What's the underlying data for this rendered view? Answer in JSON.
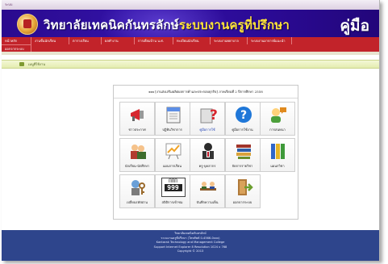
{
  "window": {
    "title": "ระบบ"
  },
  "banner": {
    "college_name": "วิทยาลัยเทคนิคกันทรลักษ์",
    "system_name": "ระบบงานครูที่ปรึกษา",
    "manual_label": "คู่มือ"
  },
  "menu": {
    "row1": [
      "หน้าหลัก",
      "งานขั้นนักเรียน",
      "ตารางเรียน",
      "ผลทำงาน",
      "การเยี่ยมบ้าน น.ศ.",
      "ทะเบียนนักเรียน",
      "ระบบงานพยาบาล",
      "ระบบงานอาจารย์แนะนำ"
    ],
    "row2": [
      "ออกจากระบบ"
    ]
  },
  "breadcrumb": {
    "text": "เมนูที่ใช้งาน"
  },
  "panel": {
    "header": "xxx [งานส่งเสริมผลิตผลการค้าและประกอบธุรกิจ] ภาคเรียนที่ 2 ปีการศึกษา 2558",
    "tiles": [
      {
        "label": "ข่าวประกาศ",
        "icon": "megaphone-icon",
        "color": "#d7262e"
      },
      {
        "label": "ปฏิทินวิชาการ",
        "icon": "calendar-icon",
        "color": "#5c8ee6"
      },
      {
        "label": "คู่มือการใช้",
        "icon": "question-book-icon",
        "color": "#d7262e"
      },
      {
        "label": "คู่มือการใช้งาน",
        "icon": "help-icon",
        "color": "#1f77d8"
      },
      {
        "label": "การสนทนา",
        "icon": "chat-users-icon",
        "color": "#e08a1e"
      },
      {
        "label": "นักเรียน-นักศึกษา",
        "icon": "students-icon",
        "color": "#3d6d2d"
      },
      {
        "label": "แผนการเรียน",
        "icon": "chart-board-icon",
        "color": "#f0a326"
      },
      {
        "label": "ครู-บุคลากร",
        "icon": "teacher-icon",
        "color": "#2a2a2a"
      },
      {
        "label": "จัดการรายวิชา",
        "icon": "books-icon",
        "color": "#a0342a"
      },
      {
        "label": "แผนกวิชา",
        "icon": "binders-icon",
        "color": "#2f66c9"
      },
      {
        "label": "เปลี่ยนรหัสผ่าน",
        "icon": "key-user-icon",
        "color": "#9a6a2c"
      },
      {
        "label": "สถิติการเข้าชม",
        "icon": "counter-icon",
        "color": "#333333"
      },
      {
        "label": "บันทึกความเห็น",
        "icon": "meeting-icon",
        "color": "#3a6a2a"
      },
      {
        "label": "ออกจากระบบ",
        "icon": "exit-door-icon",
        "color": "#6b9e2f"
      }
    ],
    "counter": {
      "top": "ΠΠΠ",
      "digits": "999",
      "caption": "สถิติการเข้าชม"
    }
  },
  "footer": {
    "lines": [
      "วิทยาลัยเทคนิคกันทรลักษ์",
      "ระบบงานครูที่ปรึกษา (โทรศัพท์ 0-4566-0xxx)",
      "Kantarak Technology and Management College",
      "Support Internet Explorer 8 Resolution 1024 x 768",
      "Copyright © 2013"
    ]
  },
  "colors": {
    "banner": "#2a0a8e",
    "menu": "#c2232a",
    "breadcrumb": "#e3ecb0",
    "footer": "#2e458c"
  }
}
